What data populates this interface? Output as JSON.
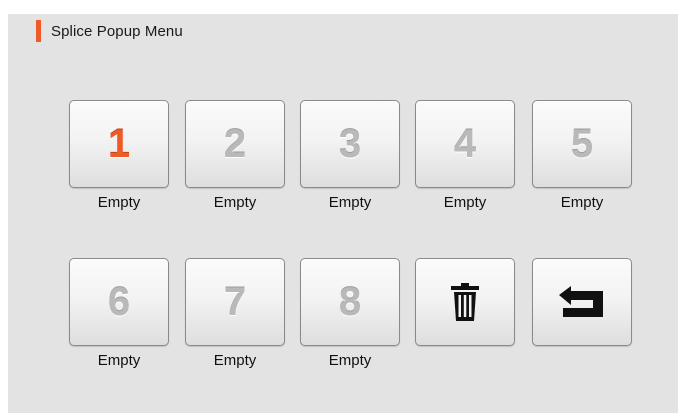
{
  "header": {
    "title": "Splice Popup Menu"
  },
  "colors": {
    "accent": "#f05a28",
    "inactive_number": "#b9b9b9",
    "icon": "#111111"
  },
  "slots": [
    {
      "number": "1",
      "label": "Empty",
      "active": true
    },
    {
      "number": "2",
      "label": "Empty",
      "active": false
    },
    {
      "number": "3",
      "label": "Empty",
      "active": false
    },
    {
      "number": "4",
      "label": "Empty",
      "active": false
    },
    {
      "number": "5",
      "label": "Empty",
      "active": false
    },
    {
      "number": "6",
      "label": "Empty",
      "active": false
    },
    {
      "number": "7",
      "label": "Empty",
      "active": false
    },
    {
      "number": "8",
      "label": "Empty",
      "active": false
    }
  ],
  "actions": {
    "delete_icon": "trash-icon",
    "back_icon": "return-arrow-icon"
  }
}
